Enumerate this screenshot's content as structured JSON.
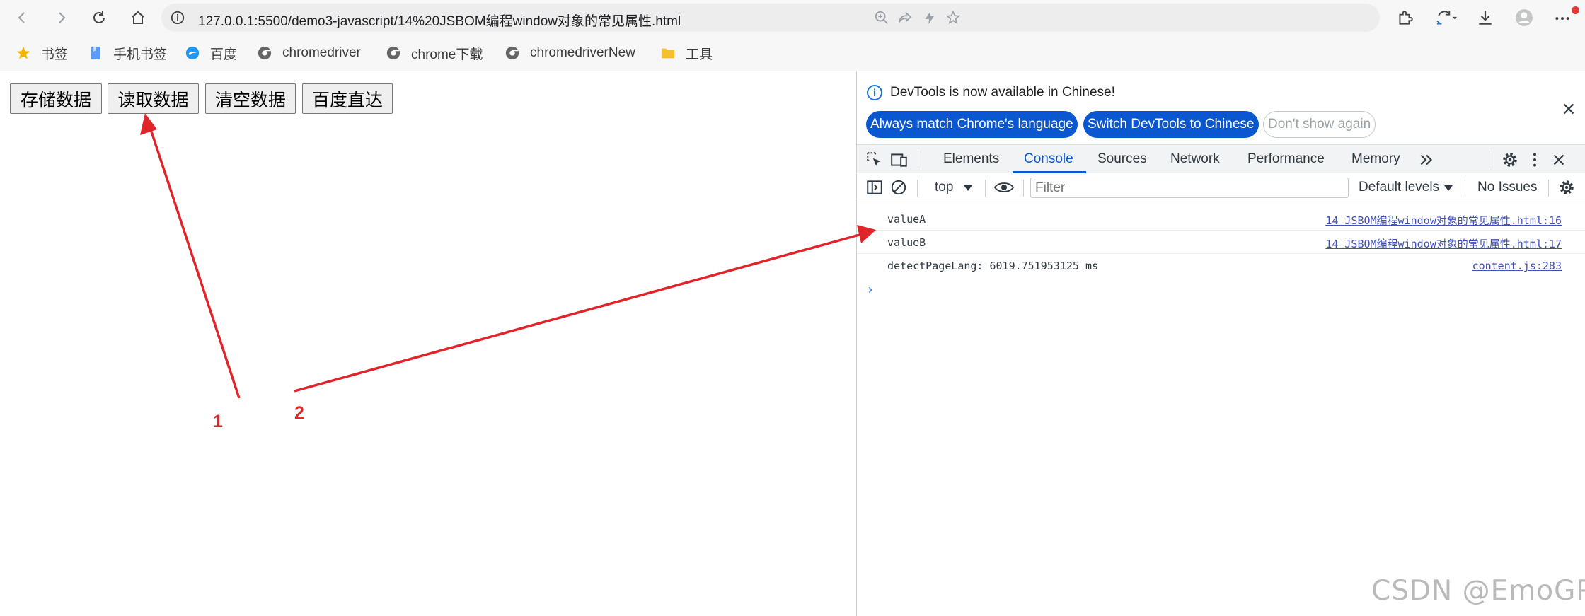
{
  "browser": {
    "url": "127.0.0.1:5500/demo3-javascript/14%20JSBOM编程window对象的常见属性.html",
    "toolbar_icons": [
      "back-icon",
      "forward-icon",
      "reload-icon",
      "home-icon",
      "zoom-icon",
      "share-icon",
      "performance-icon",
      "favorite-star-icon",
      "extensions-icon",
      "sync-icon",
      "download-icon",
      "profile-icon",
      "more-icon"
    ]
  },
  "bookmarks": [
    {
      "label": "书签",
      "icon": "star-icon"
    },
    {
      "label": "手机书签",
      "icon": "mobile-bookmark-icon"
    },
    {
      "label": "百度",
      "icon": "baidu-icon"
    },
    {
      "label": "chromedriver",
      "icon": "chrome-icon"
    },
    {
      "label": "chrome下载",
      "icon": "chrome-icon"
    },
    {
      "label": "chromedriverNew",
      "icon": "chrome-icon"
    },
    {
      "label": "工具",
      "icon": "folder-icon"
    }
  ],
  "page": {
    "buttons": [
      "存储数据",
      "读取数据",
      "清空数据",
      "百度直达"
    ],
    "annotations": [
      "1",
      "2"
    ]
  },
  "devtools": {
    "infobar": {
      "message": "DevTools is now available in Chinese!",
      "match_button": "Always match Chrome's language",
      "switch_button": "Switch DevTools to Chinese",
      "dismiss_button": "Don't show again"
    },
    "tabs": [
      "Elements",
      "Console",
      "Sources",
      "Network",
      "Performance",
      "Memory"
    ],
    "active_tab": "Console",
    "console_toolbar": {
      "context": "top",
      "filter_placeholder": "Filter",
      "levels": "Default levels",
      "issues": "No Issues"
    },
    "logs": [
      {
        "message": "valueA",
        "source": "14 JSBOM编程window对象的常见属性.html:16"
      },
      {
        "message": "valueB",
        "source": "14 JSBOM编程window对象的常见属性.html:17"
      },
      {
        "message": "detectPageLang: 6019.751953125 ms",
        "source": "content.js:283"
      }
    ],
    "prompt": "›"
  },
  "watermark": "CSDN @EmoGP",
  "colors": {
    "accent": "#0b57d0",
    "arrow": "#e0242a"
  }
}
